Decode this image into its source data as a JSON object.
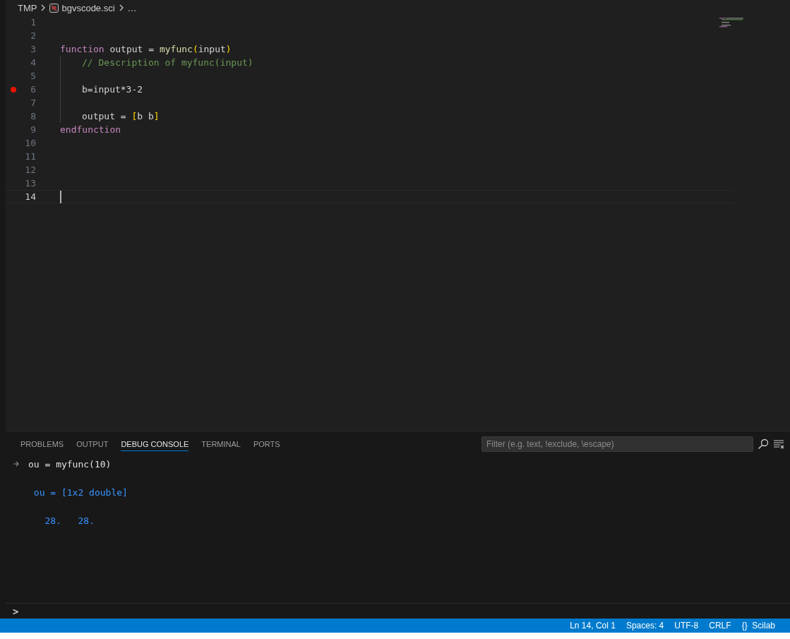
{
  "breadcrumb": [
    "TMP",
    "bgvscode.sci",
    "…"
  ],
  "editor": {
    "lines": [
      {
        "number": "1",
        "indented": false,
        "breakpoint": false,
        "current": false
      },
      {
        "number": "2",
        "indented": false,
        "breakpoint": false,
        "current": false
      },
      {
        "number": "3",
        "indented": false,
        "breakpoint": false,
        "current": false,
        "tokens": [
          {
            "text": "function",
            "kind": "keyword"
          },
          {
            "text": " output = ",
            "kind": "plain"
          },
          {
            "text": "myfunc",
            "kind": "func"
          },
          {
            "text": "(",
            "kind": "bracket"
          },
          {
            "text": "input",
            "kind": "plain"
          },
          {
            "text": ")",
            "kind": "bracket"
          }
        ]
      },
      {
        "number": "4",
        "indented": true,
        "breakpoint": false,
        "current": false,
        "tokens": [
          {
            "text": "// Description of myfunc(input)",
            "kind": "comment"
          }
        ]
      },
      {
        "number": "5",
        "indented": true,
        "breakpoint": false,
        "current": false
      },
      {
        "number": "6",
        "indented": true,
        "breakpoint": true,
        "current": false,
        "tokens": [
          {
            "text": "b=input*3-2",
            "kind": "plain"
          }
        ]
      },
      {
        "number": "7",
        "indented": true,
        "breakpoint": false,
        "current": false
      },
      {
        "number": "8",
        "indented": true,
        "breakpoint": false,
        "current": false,
        "tokens": [
          {
            "text": "output = ",
            "kind": "plain"
          },
          {
            "text": "[",
            "kind": "bracket"
          },
          {
            "text": "b b",
            "kind": "plain"
          },
          {
            "text": "]",
            "kind": "bracket"
          }
        ]
      },
      {
        "number": "9",
        "indented": false,
        "breakpoint": false,
        "current": false,
        "tokens": [
          {
            "text": "endfunction",
            "kind": "keyword"
          }
        ]
      },
      {
        "number": "10",
        "indented": false,
        "breakpoint": false,
        "current": false
      },
      {
        "number": "11",
        "indented": false,
        "breakpoint": false,
        "current": false
      },
      {
        "number": "12",
        "indented": false,
        "breakpoint": false,
        "current": false
      },
      {
        "number": "13",
        "indented": false,
        "breakpoint": false,
        "current": false
      },
      {
        "number": "14",
        "indented": false,
        "breakpoint": false,
        "current": true
      }
    ]
  },
  "panel": {
    "tabs": [
      {
        "label": "PROBLEMS",
        "selected": false
      },
      {
        "label": "OUTPUT",
        "selected": false
      },
      {
        "label": "DEBUG CONSOLE",
        "selected": true
      },
      {
        "label": "TERMINAL",
        "selected": false
      },
      {
        "label": "PORTS",
        "selected": false
      }
    ],
    "filter": {
      "placeholder": "Filter (e.g. text, !exclude, \\escape)"
    },
    "console": [
      {
        "kind": "input",
        "text": "ou = myfunc(10)"
      },
      {
        "kind": "output",
        "text": " ou = [1x2 double]"
      },
      {
        "kind": "output",
        "text": "   28.   28."
      }
    ],
    "prompt": ">"
  },
  "status_bar": [
    {
      "kind": "text",
      "text": "Ln 14, Col 1"
    },
    {
      "kind": "text",
      "text": "Spaces: 4"
    },
    {
      "kind": "text",
      "text": "UTF-8"
    },
    {
      "kind": "text",
      "text": "CRLF"
    },
    {
      "kind": "language",
      "icon": "{}",
      "text": "Scilab"
    }
  ]
}
